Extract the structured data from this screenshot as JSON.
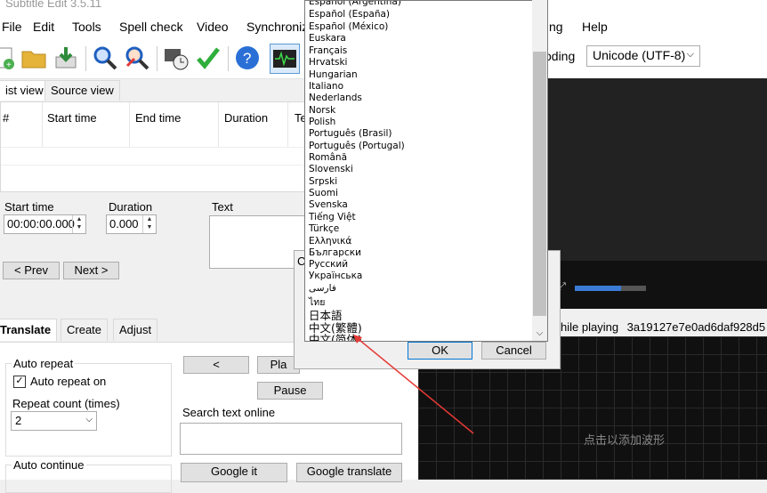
{
  "window": {
    "title": "Subtitle Edit 3.5.11"
  },
  "menu": {
    "items": [
      "File",
      "Edit",
      "Tools",
      "Spell check",
      "Video",
      "Synchronization",
      "Help"
    ],
    "partial_item": "ng"
  },
  "toolbar": {
    "encoding_label": "oding",
    "encoding_value": "Unicode (UTF-8)"
  },
  "view_tabs": [
    "ist view",
    "Source view"
  ],
  "grid": {
    "columns": [
      "#",
      "Start time",
      "End time",
      "Duration",
      "Te"
    ]
  },
  "editor": {
    "start_time_label": "Start time",
    "start_time_value": "00:00:00.000",
    "duration_label": "Duration",
    "duration_value": "0.000",
    "text_label": "Text",
    "prev_label": "< Prev",
    "next_label": "Next >"
  },
  "bottom_tabs": [
    "Translate",
    "Create",
    "Adjust"
  ],
  "translate": {
    "auto_repeat_title": "Auto repeat",
    "auto_repeat_on_label": "Auto repeat on",
    "repeat_count_label": "Repeat count (times)",
    "repeat_count_value": "2",
    "auto_continue_title": "Auto continue",
    "back_label": "<",
    "play_label": "Pla",
    "pause_label": "Pause",
    "search_label": "Search text online",
    "google_it_label": "Google it",
    "google_translate_label": "Google translate"
  },
  "video": {
    "playing_label": "hile playing",
    "hash_text": "3a19127e7e0ad6daf928d5",
    "waveform_hint": "点击以添加波形",
    "progress": 0.65
  },
  "dialog": {
    "letter": "C",
    "ok_label": "OK",
    "cancel_label": "Cancel"
  },
  "language_list": [
    "Español (Argentina)",
    "Español (España)",
    "Español (México)",
    "Euskara",
    "Français",
    "Hrvatski",
    "Hungarian",
    "Italiano",
    "Nederlands",
    "Norsk",
    "Polish",
    "Português (Brasil)",
    "Português (Portugal)",
    "Română",
    "Slovenski",
    "Srpski",
    "Suomi",
    "Svenska",
    "Tiếng Việt",
    "Türkçe",
    "Ελληνικά",
    "Български",
    "Русский",
    "Українська",
    "فارسی",
    "ไทย",
    "日本語",
    "中文(繁體)",
    "中文(简体)"
  ],
  "colors": {
    "accent": "#0078d7",
    "arrow": "#e53935"
  }
}
